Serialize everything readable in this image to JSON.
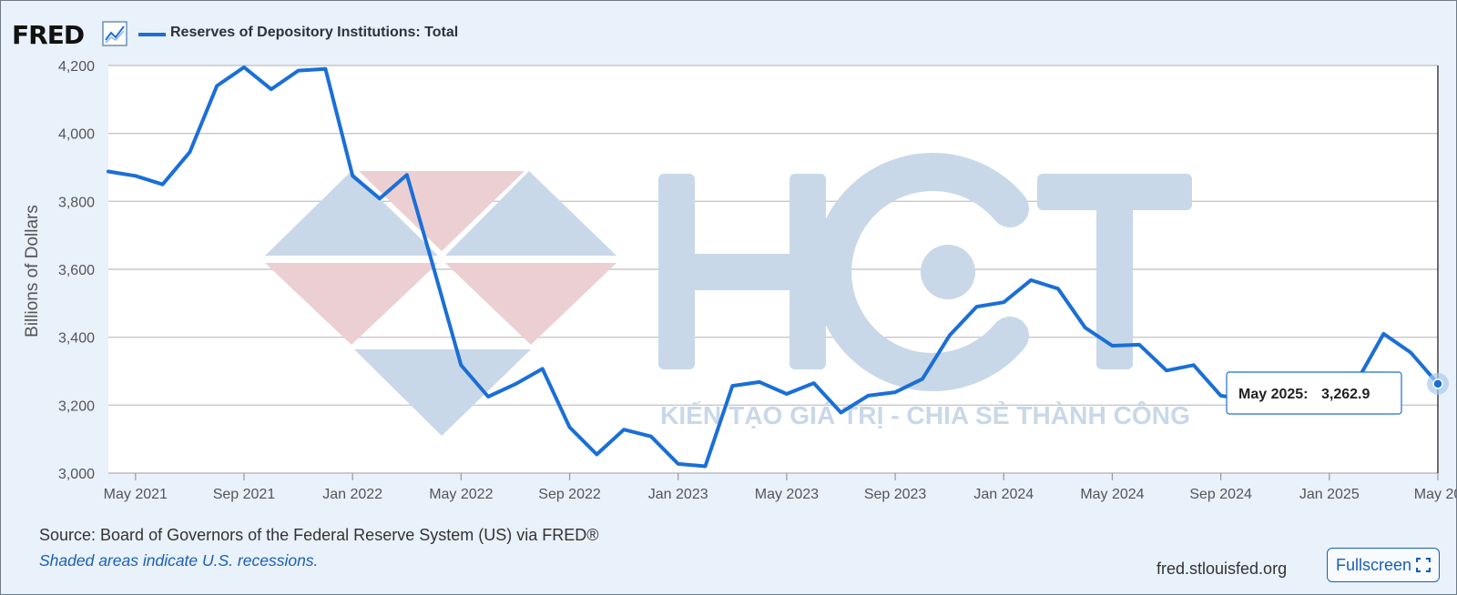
{
  "header": {
    "logo_text": "FRED",
    "logo_icon": "line-chart-icon",
    "legend_label": "Reserves of Depository Institutions: Total",
    "series_color": "#1a6fd6"
  },
  "watermark": {
    "text": "HCT",
    "tagline": "KIẾN TẠO GIÁ TRỊ - CHIA SẺ THÀNH CÔNG",
    "colors": {
      "blue": "#c9d8e8",
      "red": "#eccfd2"
    }
  },
  "tooltip": {
    "label": "May 2025:",
    "value": "3,262.9"
  },
  "footer": {
    "source": "Source: Board of Governors of the Federal Reserve System (US) via FRED®",
    "recession_note": "Shaded areas indicate U.S. recessions.",
    "site": "fred.stlouisfed.org",
    "fullscreen_label": "Fullscreen",
    "fullscreen_icon": "expand-icon"
  },
  "chart_data": {
    "type": "line",
    "title": "",
    "xlabel": "",
    "ylabel": "Billions of Dollars",
    "ylim": [
      3000,
      4200
    ],
    "yticks": [
      3000,
      3200,
      3400,
      3600,
      3800,
      4000,
      4200
    ],
    "ytick_labels": [
      "3,000",
      "3,200",
      "3,400",
      "3,600",
      "3,800",
      "4,000",
      "4,200"
    ],
    "xlim": [
      "2021-04",
      "2025-05"
    ],
    "xticks": [
      "2021-05",
      "2021-09",
      "2022-01",
      "2022-05",
      "2022-09",
      "2023-01",
      "2023-05",
      "2023-09",
      "2024-01",
      "2024-05",
      "2024-09",
      "2025-01",
      "2025-05"
    ],
    "xtick_labels": [
      "May 2021",
      "Sep 2021",
      "Jan 2022",
      "May 2022",
      "Sep 2022",
      "Jan 2023",
      "May 2023",
      "Sep 2023",
      "Jan 2024",
      "May 2024",
      "Sep 2024",
      "Jan 2025",
      "May 20"
    ],
    "grid": true,
    "series": [
      {
        "name": "Reserves of Depository Institutions: Total",
        "color": "#1a6fd6",
        "x": [
          "2021-04",
          "2021-05",
          "2021-06",
          "2021-07",
          "2021-08",
          "2021-09",
          "2021-10",
          "2021-11",
          "2021-12",
          "2022-01",
          "2022-02",
          "2022-03",
          "2022-04",
          "2022-05",
          "2022-06",
          "2022-07",
          "2022-08",
          "2022-09",
          "2022-10",
          "2022-11",
          "2022-12",
          "2023-01",
          "2023-02",
          "2023-03",
          "2023-04",
          "2023-05",
          "2023-06",
          "2023-07",
          "2023-08",
          "2023-09",
          "2023-10",
          "2023-11",
          "2023-12",
          "2024-01",
          "2024-02",
          "2024-03",
          "2024-04",
          "2024-05",
          "2024-06",
          "2024-07",
          "2024-08",
          "2024-09",
          "2024-10",
          "2024-11",
          "2024-12",
          "2025-01",
          "2025-02",
          "2025-03",
          "2025-04",
          "2025-05"
        ],
        "y": [
          3888,
          3875,
          3850,
          3945,
          4140,
          4195,
          4130,
          4185,
          4190,
          3875,
          3808,
          3878,
          3600,
          3318,
          3225,
          3262,
          3307,
          3135,
          3055,
          3128,
          3108,
          3027,
          3020,
          3257,
          3268,
          3233,
          3265,
          3178,
          3228,
          3238,
          3277,
          3405,
          3490,
          3503,
          3568,
          3543,
          3428,
          3375,
          3378,
          3302,
          3318,
          3228,
          3215,
          3222,
          3218,
          3220,
          3268,
          3410,
          3355,
          3263
        ]
      }
    ]
  }
}
